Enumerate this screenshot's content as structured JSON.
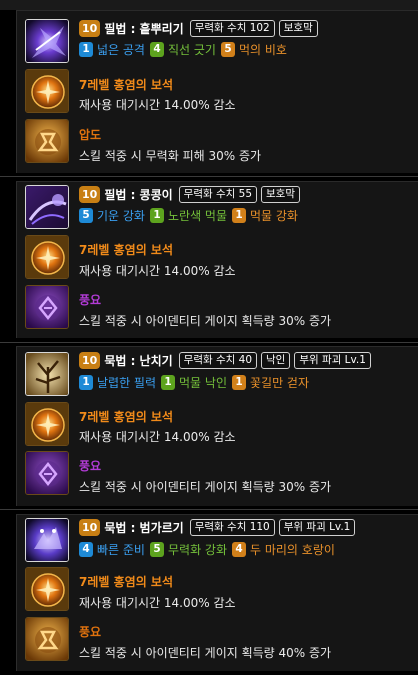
{
  "header": {
    "ghost_text": ""
  },
  "colors": {
    "blue": "#1e8ad6",
    "green": "#5da31e",
    "orange": "#d1801a",
    "gem_name": "#f08a1a",
    "rune_orange": "#e0720e",
    "rune_purple": "#b23bd6"
  },
  "skills": [
    {
      "level": "10",
      "name": "필법 : 흩뿌리기",
      "tags": [
        "무력화 수치 102",
        "보호막"
      ],
      "tripods": [
        {
          "num": "1",
          "name": "넓은 공격",
          "color": "blue"
        },
        {
          "num": "4",
          "name": "직선 긋기",
          "color": "green"
        },
        {
          "num": "5",
          "name": "먹의 비호",
          "color": "orange"
        }
      ],
      "gem": {
        "name": "7레벨 홍염의 보석",
        "desc": "재사용 대기시간 14.00% 감소"
      },
      "rune": {
        "name": "압도",
        "desc": "스킬 적중 시 무력화 피해 30% 증가",
        "color": "rune_orange"
      }
    },
    {
      "level": "10",
      "name": "필법 : 콩콩이",
      "tags": [
        "무력화 수치 55",
        "보호막"
      ],
      "tripods": [
        {
          "num": "5",
          "name": "기운 강화",
          "color": "blue"
        },
        {
          "num": "1",
          "name": "노란색 먹물",
          "color": "green"
        },
        {
          "num": "1",
          "name": "먹물 강화",
          "color": "orange"
        }
      ],
      "gem": {
        "name": "7레벨 홍염의 보석",
        "desc": "재사용 대기시간 14.00% 감소"
      },
      "rune": {
        "name": "풍요",
        "desc": "스킬 적중 시 아이덴티티 게이지 획득량 30% 증가",
        "color": "rune_purple"
      }
    },
    {
      "level": "10",
      "name": "묵법 : 난치기",
      "tags": [
        "무력화 수치 40",
        "낙인",
        "부위 파괴 Lv.1"
      ],
      "tripods": [
        {
          "num": "1",
          "name": "날렵한 필력",
          "color": "blue"
        },
        {
          "num": "1",
          "name": "먹물 낙인",
          "color": "green"
        },
        {
          "num": "1",
          "name": "꽃길만 걷자",
          "color": "orange"
        }
      ],
      "gem": {
        "name": "7레벨 홍염의 보석",
        "desc": "재사용 대기시간 14.00% 감소"
      },
      "rune": {
        "name": "풍요",
        "desc": "스킬 적중 시 아이덴티티 게이지 획득량 30% 증가",
        "color": "rune_purple"
      }
    },
    {
      "level": "10",
      "name": "묵법 : 범가르기",
      "tags": [
        "무력화 수치 110",
        "부위 파괴 Lv.1"
      ],
      "tripods": [
        {
          "num": "4",
          "name": "빠른 준비",
          "color": "blue"
        },
        {
          "num": "5",
          "name": "무력화 강화",
          "color": "green"
        },
        {
          "num": "4",
          "name": "두 마리의 호랑이",
          "color": "orange"
        }
      ],
      "gem": {
        "name": "7레벨 홍염의 보석",
        "desc": "재사용 대기시간 14.00% 감소"
      },
      "rune": {
        "name": "풍요",
        "desc": "스킬 적중 시 아이덴티티 게이지 획득량 40% 증가",
        "color": "rune_orange"
      }
    }
  ]
}
